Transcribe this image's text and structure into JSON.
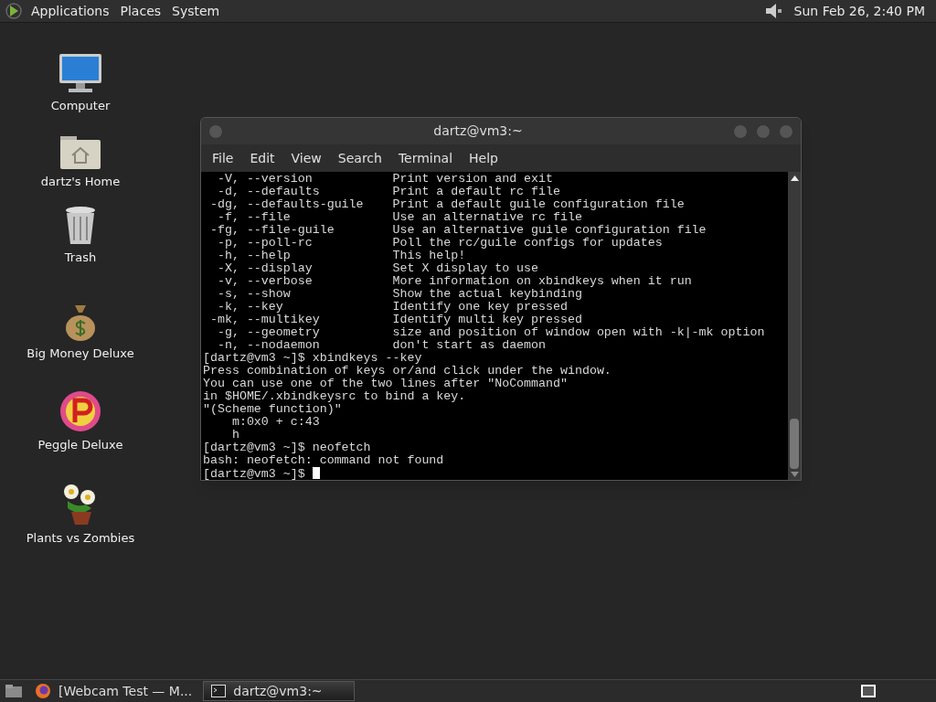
{
  "top_panel": {
    "menus": [
      "Applications",
      "Places",
      "System"
    ],
    "clock": "Sun Feb 26, 2:40 PM"
  },
  "desktop_icons": [
    {
      "kind": "computer",
      "label": "Computer"
    },
    {
      "kind": "home",
      "label": "dartz's Home"
    },
    {
      "kind": "trash",
      "label": "Trash"
    },
    {
      "kind": "money",
      "label": "Big Money Deluxe"
    },
    {
      "kind": "peggle",
      "label": "Peggle Deluxe"
    },
    {
      "kind": "plant",
      "label": "Plants vs Zombies"
    }
  ],
  "terminal": {
    "title": "dartz@vm3:~",
    "menu": [
      "File",
      "Edit",
      "View",
      "Search",
      "Terminal",
      "Help"
    ],
    "lines": [
      "  -V, --version           Print version and exit",
      "  -d, --defaults          Print a default rc file",
      " -dg, --defaults-guile    Print a default guile configuration file",
      "  -f, --file              Use an alternative rc file",
      " -fg, --file-guile        Use an alternative guile configuration file",
      "  -p, --poll-rc           Poll the rc/guile configs for updates",
      "  -h, --help              This help!",
      "  -X, --display           Set X display to use",
      "  -v, --verbose           More information on xbindkeys when it run",
      "  -s, --show              Show the actual keybinding",
      "  -k, --key               Identify one key pressed",
      " -mk, --multikey          Identify multi key pressed",
      "  -g, --geometry          size and position of window open with -k|-mk option",
      "  -n, --nodaemon          don't start as daemon",
      "[dartz@vm3 ~]$ xbindkeys --key",
      "Press combination of keys or/and click under the window.",
      "You can use one of the two lines after \"NoCommand\"",
      "in $HOME/.xbindkeysrc to bind a key.",
      "\"(Scheme function)\"",
      "    m:0x0 + c:43",
      "    h",
      "[dartz@vm3 ~]$ neofetch",
      "bash: neofetch: command not found",
      "[dartz@vm3 ~]$ "
    ]
  },
  "taskbar": {
    "tasks": [
      {
        "kind": "browser",
        "label": "[Webcam Test — M...",
        "selected": false
      },
      {
        "kind": "terminal",
        "label": "dartz@vm3:~",
        "selected": true
      }
    ]
  }
}
